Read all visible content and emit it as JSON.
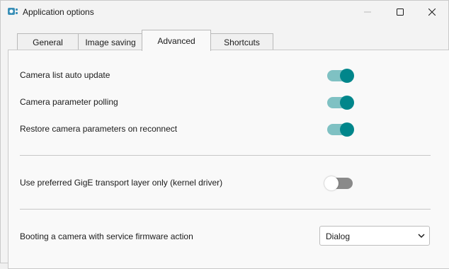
{
  "window": {
    "title": "Application options",
    "controls": [
      "minimize-icon",
      "maximize-icon",
      "close-icon"
    ]
  },
  "tabs": [
    {
      "label": "General",
      "active": false
    },
    {
      "label": "Image saving",
      "active": false
    },
    {
      "label": "Advanced",
      "active": true
    },
    {
      "label": "Shortcuts",
      "active": false
    }
  ],
  "settings": {
    "camera_list_auto_update": {
      "label": "Camera list auto update",
      "enabled": true
    },
    "camera_parameter_polling": {
      "label": "Camera parameter polling",
      "enabled": true
    },
    "restore_camera_parameters": {
      "label": "Restore camera parameters on reconnect",
      "enabled": true
    },
    "preferred_gige_transport": {
      "label": "Use preferred GigE transport layer only (kernel driver)",
      "enabled": false
    },
    "service_firmware_action": {
      "label": "Booting a camera with service firmware action",
      "value": "Dialog"
    }
  },
  "colors": {
    "accent": "#00868b",
    "track_on": "#7fc1c3",
    "track_off": "#8a8a8a"
  }
}
